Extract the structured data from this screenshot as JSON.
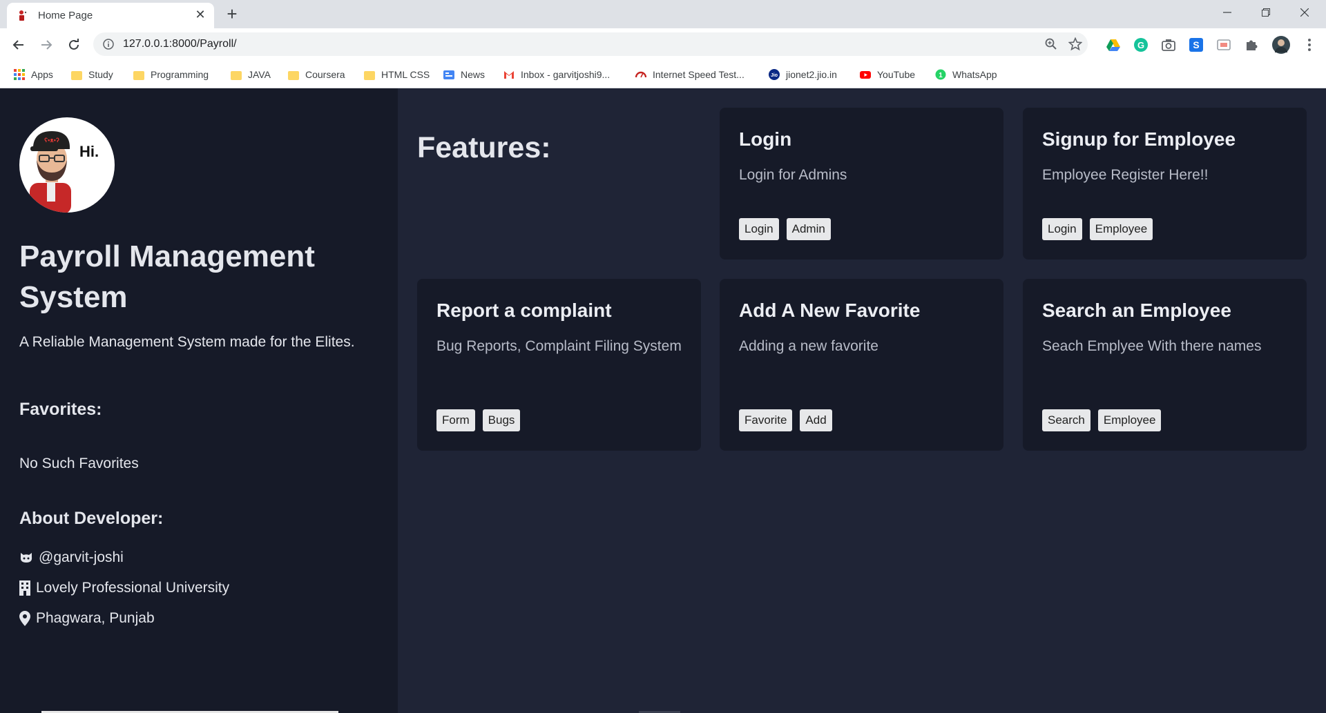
{
  "browser": {
    "tab_title": "Home Page",
    "new_tab_symbol": "+",
    "url": "127.0.0.1:8000/Payroll/",
    "bookmarks": [
      {
        "label": "Apps",
        "icon": "apps-grid-icon"
      },
      {
        "label": "Study",
        "icon": "folder-icon"
      },
      {
        "label": "Programming",
        "icon": "folder-icon"
      },
      {
        "label": "JAVA",
        "icon": "folder-icon"
      },
      {
        "label": "Coursera",
        "icon": "folder-icon"
      },
      {
        "label": "HTML CSS",
        "icon": "folder-icon"
      },
      {
        "label": "News",
        "icon": "google-news-icon"
      },
      {
        "label": "Inbox - garvitjoshi9...",
        "icon": "gmail-icon"
      },
      {
        "label": "Internet Speed Test...",
        "icon": "speedometer-icon"
      },
      {
        "label": "jionet2.jio.in",
        "icon": "jio-icon"
      },
      {
        "label": "YouTube",
        "icon": "youtube-icon"
      },
      {
        "label": "WhatsApp",
        "icon": "whatsapp-icon"
      }
    ]
  },
  "sidebar": {
    "avatar_text": "Hi.",
    "title": "Payroll Management System",
    "tagline": "A Reliable Management System made for the Elites.",
    "favorites_heading": "Favorites:",
    "favorites_empty": "No Such Favorites",
    "about_heading": "About Developer:",
    "about": [
      {
        "icon": "github-icon",
        "text": "@garvit-joshi"
      },
      {
        "icon": "building-icon",
        "text": "Lovely Professional University"
      },
      {
        "icon": "map-marker-icon",
        "text": "Phagwara, Punjab"
      }
    ]
  },
  "main": {
    "features_heading": "Features:",
    "cards": [
      {
        "title": "Login",
        "desc": "Login for Admins",
        "buttons": [
          "Login",
          "Admin"
        ]
      },
      {
        "title": "Signup for Employee",
        "desc": "Employee Register Here!!",
        "buttons": [
          "Login",
          "Employee"
        ]
      },
      {
        "title": "Report a complaint",
        "desc": "Bug Reports, Complaint Filing System",
        "buttons": [
          "Form",
          "Bugs"
        ]
      },
      {
        "title": "Add A New Favorite",
        "desc": "Adding a new favorite",
        "buttons": [
          "Favorite",
          "Add"
        ]
      },
      {
        "title": "Search an Employee",
        "desc": "Seach Emplyee With there names",
        "buttons": [
          "Search",
          "Employee"
        ]
      }
    ]
  },
  "colors": {
    "sidebar_bg": "#161a28",
    "main_bg": "#1f2436",
    "card_bg": "#161a28",
    "button_bg": "#e7e8ea"
  }
}
